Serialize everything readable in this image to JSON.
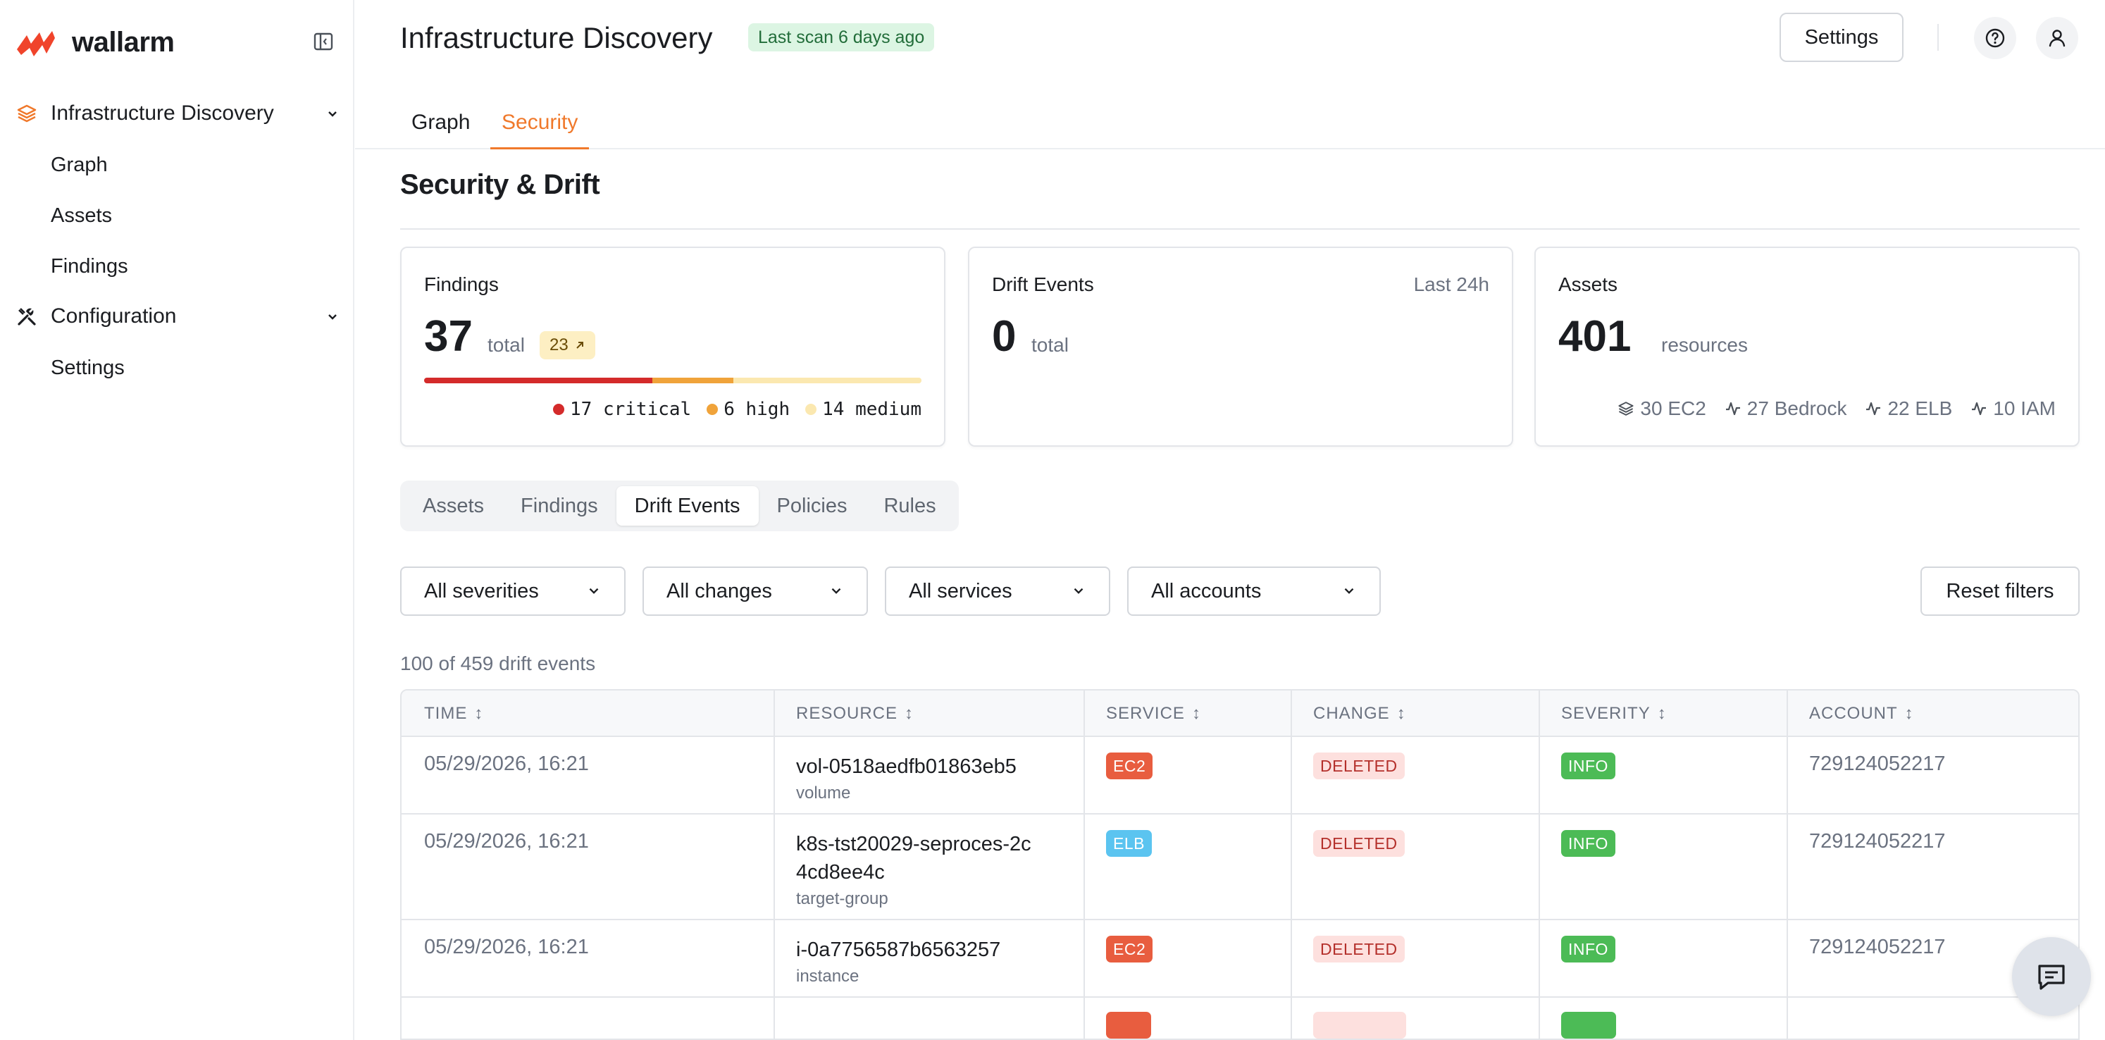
{
  "brand": {
    "name": "wallarm",
    "accent": "#f0792b"
  },
  "sidebar": {
    "groups": [
      {
        "label": "Infrastructure Discovery",
        "icon": "layers-icon",
        "items": [
          "Graph",
          "Assets",
          "Findings"
        ]
      },
      {
        "label": "Configuration",
        "icon": "tools-icon",
        "items": [
          "Settings"
        ]
      }
    ]
  },
  "header": {
    "title": "Infrastructure Discovery",
    "scan_badge": "Last scan 6 days ago",
    "settings_label": "Settings"
  },
  "tabs": [
    {
      "label": "Graph",
      "active": false
    },
    {
      "label": "Security",
      "active": true
    }
  ],
  "section": {
    "title": "Security & Drift"
  },
  "cards": {
    "findings": {
      "title": "Findings",
      "total": "37",
      "unit": "total",
      "trend": "23",
      "critical": 17,
      "high": 6,
      "medium": 14,
      "critical_label": "17 critical",
      "high_label": "6 high",
      "medium_label": "14 medium",
      "colors": {
        "critical": "#d42b2b",
        "high": "#f0a33a",
        "medium": "#fbe8b0"
      }
    },
    "drift": {
      "title": "Drift Events",
      "aside": "Last 24h",
      "total": "0",
      "unit": "total"
    },
    "assets": {
      "title": "Assets",
      "total": "401",
      "unit": "resources",
      "breakdown": [
        {
          "label": "30 EC2",
          "icon": "layers-icon"
        },
        {
          "label": "27 Bedrock",
          "icon": "activity-icon"
        },
        {
          "label": "22 ELB",
          "icon": "activity-icon"
        },
        {
          "label": "10 IAM",
          "icon": "activity-icon"
        }
      ]
    }
  },
  "segments": [
    {
      "label": "Assets",
      "active": false
    },
    {
      "label": "Findings",
      "active": false
    },
    {
      "label": "Drift Events",
      "active": true
    },
    {
      "label": "Policies",
      "active": false
    },
    {
      "label": "Rules",
      "active": false
    }
  ],
  "filters": {
    "severity": "All severities",
    "changes": "All changes",
    "services": "All services",
    "accounts": "All accounts",
    "reset_label": "Reset filters"
  },
  "table": {
    "count_text": "100 of 459 drift events",
    "columns": [
      "TIME",
      "RESOURCE",
      "SERVICE",
      "CHANGE",
      "SEVERITY",
      "ACCOUNT"
    ],
    "rows": [
      {
        "time": "05/29/2026, 16:21",
        "resource": "vol-0518aedfb01863eb5",
        "type": "volume",
        "service": "EC2",
        "change": "DELETED",
        "severity": "INFO",
        "account": "729124052217"
      },
      {
        "time": "05/29/2026, 16:21",
        "resource": "k8s-tst20029-seproces-2c4cd8ee4c",
        "type": "target-group",
        "service": "ELB",
        "change": "DELETED",
        "severity": "INFO",
        "account": "729124052217"
      },
      {
        "time": "05/29/2026, 16:21",
        "resource": "i-0a7756587b6563257",
        "type": "instance",
        "service": "EC2",
        "change": "DELETED",
        "severity": "INFO",
        "account": "729124052217"
      }
    ]
  }
}
